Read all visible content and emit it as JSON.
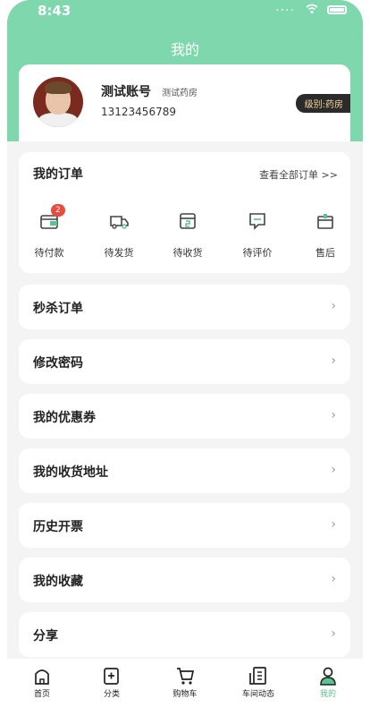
{
  "status": {
    "time": "8:43",
    "dots": "...."
  },
  "header": {
    "title": "我的"
  },
  "profile": {
    "name": "测试账号",
    "role": "测试药房",
    "phone": "13123456789",
    "level": "级别:药房"
  },
  "orders": {
    "title": "我的订单",
    "view_all": "查看全部订单 >>",
    "items": [
      {
        "label": "待付款",
        "badge": "2"
      },
      {
        "label": "待发货"
      },
      {
        "label": "待收货"
      },
      {
        "label": "待评价"
      },
      {
        "label": "售后"
      }
    ]
  },
  "menu": [
    {
      "label": "秒杀订单"
    },
    {
      "label": "修改密码"
    },
    {
      "label": "我的优惠券"
    },
    {
      "label": "我的收货地址"
    },
    {
      "label": "历史开票"
    },
    {
      "label": "我的收藏"
    },
    {
      "label": "分享"
    }
  ],
  "arrow": "›",
  "tabbar": [
    {
      "label": "首页"
    },
    {
      "label": "分类"
    },
    {
      "label": "购物车"
    },
    {
      "label": "车间动态"
    },
    {
      "label": "我的"
    }
  ],
  "colors": {
    "accent": "#7ed7ad",
    "active": "#5ac391",
    "badge": "#e84c3d",
    "level_bg": "#2b2b2b",
    "level_text": "#f6d9a0"
  }
}
